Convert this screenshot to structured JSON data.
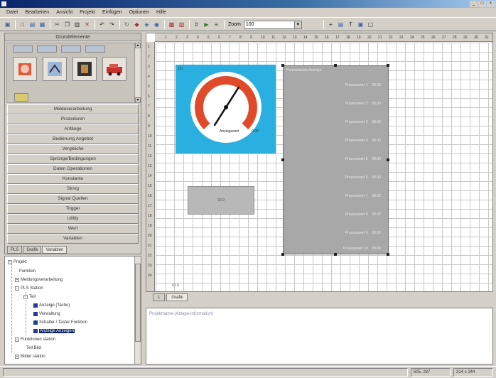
{
  "window": {
    "title": ""
  },
  "menu": [
    "Datei",
    "Bearbeiten",
    "Ansicht",
    "Projekt",
    "Einfügen",
    "Optionen",
    "Hilfe"
  ],
  "toolbar": {
    "zoom_label": "Zoom",
    "zoom_value": "100"
  },
  "library": {
    "title": "Grundelemente"
  },
  "categories": [
    "Meldeverarbeitung",
    "Prozeduren",
    "Anfänge",
    "Bedienung Angebot",
    "Vergleiche",
    "Sprünge/Bedingungen",
    "Daten Operationen",
    "Konstante",
    "String",
    "Signal Quellen",
    "Trigger",
    "Utility",
    "Wert",
    "Variablen"
  ],
  "left_tabs": [
    "PLS",
    "Grafik",
    "Variablen"
  ],
  "tree": {
    "items": [
      "Projekt",
      "Funktion",
      "Meldungsverarbeitung",
      "PLS Station",
      "Teil",
      "Anzeige (Tacho)",
      "Verwaltung",
      "Schalter / Taster Funktion",
      "Anzeige Anzeigen",
      "Funktionen station",
      "Teil Bild",
      "Bilder station"
    ]
  },
  "canvas": {
    "ruler_x": [
      "1",
      "2",
      "3",
      "4",
      "5",
      "6",
      "7",
      "8",
      "9",
      "10",
      "11",
      "12",
      "13",
      "14",
      "15",
      "16",
      "17",
      "18",
      "19",
      "20",
      "21",
      "22",
      "23",
      "24",
      "25",
      "26",
      "27",
      "28",
      "29",
      "30",
      "31"
    ],
    "ruler_y": [
      "1",
      "2",
      "3",
      "4",
      "5",
      "6",
      "7",
      "8",
      "9",
      "10",
      "11",
      "12",
      "13",
      "14",
      "15",
      "16",
      "17",
      "18",
      "19",
      "20",
      "21",
      "22",
      "23",
      "24"
    ],
    "gauge": {
      "tag": "(1)",
      "label": "Anzeigewert",
      "value": "0.00",
      "level": 0.62
    },
    "small_box": "00.0",
    "panel": {
      "title": "Prozesswerte Anzeige",
      "rows": [
        {
          "label": "Prozesswert 1",
          "value": "00.00"
        },
        {
          "label": "Prozesswert 2",
          "value": "00.00"
        },
        {
          "label": "Prozesswert 3",
          "value": "00.00"
        },
        {
          "label": "Prozesswert 4",
          "value": "00.00"
        },
        {
          "label": "Prozesswert 5",
          "value": "00.00"
        },
        {
          "label": "Prozesswert 6",
          "value": "00.00"
        },
        {
          "label": "Prozesswert 7",
          "value": "00.00"
        },
        {
          "label": "Prozesswert 8",
          "value": "00.00"
        },
        {
          "label": "Prozesswert 9",
          "value": "00.00"
        },
        {
          "label": "Prozesswert 10",
          "value": "00.00"
        }
      ]
    },
    "caption": "#1.0"
  },
  "canvas_tabs": [
    "1",
    "Grafik"
  ],
  "output": {
    "text": "Projektname (Ablage-Information)"
  },
  "status": {
    "coords": "505, 287",
    "size": "314 x 244"
  }
}
